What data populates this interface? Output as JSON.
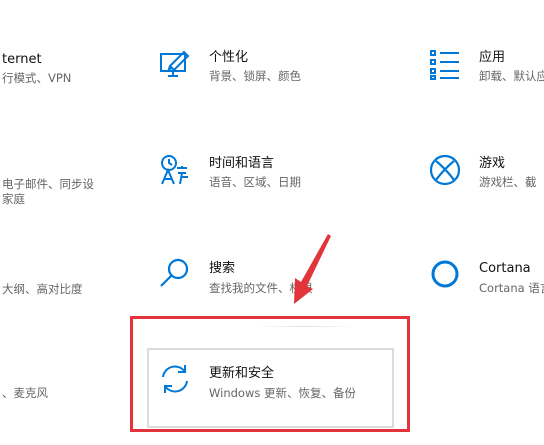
{
  "colors": {
    "accent": "#0078d7",
    "highlight": "#e2353b",
    "text": "#111111",
    "subtext": "#666666"
  },
  "left_column": {
    "item1_title_partial": "ternet",
    "item1_desc_partial": "行模式、VPN",
    "item2_desc_line1_partial": "电子邮件、同步设",
    "item2_desc_line2_partial": "家庭",
    "item3_desc_partial": "大纲、高对比度",
    "item4_desc_partial": "、麦克风"
  },
  "middle_column": {
    "personalization": {
      "icon": "personalization-icon",
      "title": "个性化",
      "desc": "背景、锁屏、颜色"
    },
    "time_language": {
      "icon": "time-language-icon",
      "title": "时间和语言",
      "desc": "语音、区域、日期"
    },
    "search": {
      "icon": "search-icon",
      "title": "搜索",
      "desc": "查找我的文件、权限"
    },
    "update_security": {
      "icon": "update-sync-icon",
      "title": "更新和安全",
      "desc": "Windows 更新、恢复、备份"
    }
  },
  "right_column": {
    "apps": {
      "icon": "apps-list-icon",
      "title": "应用",
      "desc_partial": "卸载、默认应"
    },
    "gaming": {
      "icon": "xbox-icon",
      "title": "游戏",
      "desc_partial": "游戏栏、截"
    },
    "cortana": {
      "icon": "cortana-icon",
      "title": "Cortana",
      "desc_partial": "Cortana 语言"
    }
  }
}
